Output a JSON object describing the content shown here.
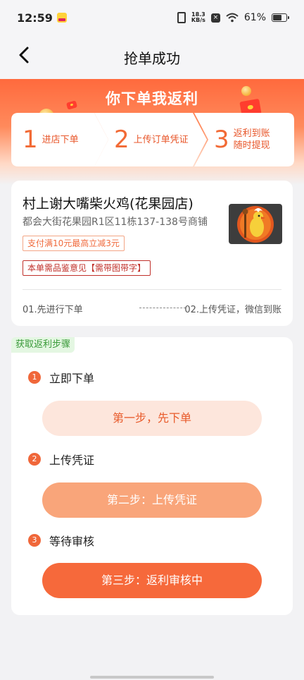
{
  "status_bar": {
    "time": "12:59",
    "net_speed_value": "18.3",
    "net_speed_unit": "KB/s",
    "battery": "61%"
  },
  "nav": {
    "title": "抢单成功"
  },
  "banner": {
    "title": "你下单我返利",
    "steps": [
      {
        "num": "1",
        "text_line1": "进店下单",
        "text_line2": ""
      },
      {
        "num": "2",
        "text_line1": "上传订单凭证",
        "text_line2": ""
      },
      {
        "num": "3",
        "text_line1": "返利到账",
        "text_line2": "随时提现"
      }
    ]
  },
  "store": {
    "name": "村上谢大嘴柴火鸡(花果园店)",
    "address": "都会大街花果园R1区11栋137-138号商铺",
    "tag_discount": "支付满10元最高立减3元",
    "tag_requirement": "本单需品鉴意见【需带图带字】",
    "flow_left": "01.先进行下单",
    "flow_right": "02.上传凭证，微信到账"
  },
  "rebate_steps": {
    "tag": "获取返利步骤",
    "items": [
      {
        "num": "1",
        "label": "立即下单",
        "button": "第一步，先下单"
      },
      {
        "num": "2",
        "label": "上传凭证",
        "button": "第二步：上传凭证"
      },
      {
        "num": "3",
        "label": "等待审核",
        "button": "第三步：返利审核中"
      }
    ]
  },
  "colors": {
    "accent": "#f6693b",
    "banner_top": "#ff6a3d",
    "tag_green_bg": "#e4f7e2",
    "tag_green_text": "#3a9a3a"
  }
}
